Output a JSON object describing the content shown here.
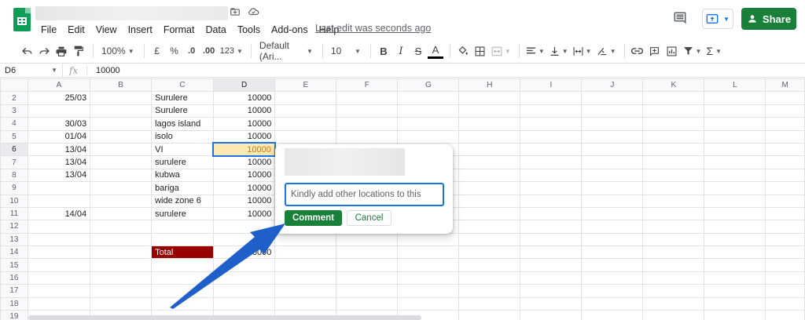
{
  "header": {
    "menu": [
      "File",
      "Edit",
      "View",
      "Insert",
      "Format",
      "Data",
      "Tools",
      "Add-ons",
      "Help"
    ],
    "last_edit": "Last edit was seconds ago",
    "share_label": "Share"
  },
  "toolbar": {
    "zoom": "100%",
    "currency": "£",
    "percent": "%",
    "decimal_decrease": ".0",
    "decimal_increase": ".00",
    "more_formats": "123",
    "font": "Default (Ari...",
    "font_size": "10",
    "bold": "B",
    "italic": "I",
    "strike": "S",
    "text_color": "A",
    "sum": "Σ"
  },
  "formula_bar": {
    "cell_ref": "D6",
    "fx": "fx",
    "value": "10000"
  },
  "sheet": {
    "columns": [
      "A",
      "B",
      "C",
      "D",
      "E",
      "F",
      "G",
      "H",
      "I",
      "J",
      "K",
      "L",
      "M"
    ],
    "rows": [
      {
        "n": "2",
        "a": "25/03",
        "b": "",
        "c": "Surulere",
        "d": "10000"
      },
      {
        "n": "3",
        "a": "",
        "b": "",
        "c": "Surulere",
        "d": "10000"
      },
      {
        "n": "4",
        "a": "30/03",
        "b": "",
        "c": "lagos island",
        "d": "10000"
      },
      {
        "n": "5",
        "a": "01/04",
        "b": "",
        "c": "isolo",
        "d": "10000"
      },
      {
        "n": "6",
        "a": "13/04",
        "b": "",
        "c": "VI",
        "d": "10000"
      },
      {
        "n": "7",
        "a": "13/04",
        "b": "",
        "c": "surulere",
        "d": "10000"
      },
      {
        "n": "8",
        "a": "13/04",
        "b": "",
        "c": "kubwa",
        "d": "10000"
      },
      {
        "n": "9",
        "a": "",
        "b": "",
        "c": "bariga",
        "d": "10000"
      },
      {
        "n": "10",
        "a": "",
        "b": "",
        "c": "wide zone 6",
        "d": "10000"
      },
      {
        "n": "11",
        "a": "14/04",
        "b": "",
        "c": "surulere",
        "d": "10000"
      },
      {
        "n": "12",
        "a": "",
        "b": "",
        "c": "",
        "d": ""
      },
      {
        "n": "13",
        "a": "",
        "b": "",
        "c": "",
        "d": ""
      },
      {
        "n": "14",
        "a": "",
        "b": "",
        "c": "Total",
        "d": "00000"
      },
      {
        "n": "15",
        "a": "",
        "b": "",
        "c": "",
        "d": ""
      },
      {
        "n": "16",
        "a": "",
        "b": "",
        "c": "",
        "d": ""
      },
      {
        "n": "17",
        "a": "",
        "b": "",
        "c": "",
        "d": ""
      },
      {
        "n": "18",
        "a": "",
        "b": "",
        "c": "",
        "d": ""
      },
      {
        "n": "19",
        "a": "",
        "b": "",
        "c": "",
        "d": ""
      }
    ]
  },
  "comment_box": {
    "text": "Kindly add other locations to this",
    "comment_label": "Comment",
    "cancel_label": "Cancel"
  },
  "colors": {
    "brand_green": "#188038",
    "total_fill": "#980000",
    "active_fill": "#fce8b2",
    "selection_blue": "#1a73e8",
    "arrow_blue": "#1f5fc9"
  },
  "icons": [
    "sheets-logo-icon",
    "move-to-folder-icon",
    "cloud-saved-icon",
    "comment-history-icon",
    "present-icon",
    "person-add-icon",
    "undo-icon",
    "redo-icon",
    "print-icon",
    "paint-format-icon",
    "fill-color-icon",
    "borders-icon",
    "merge-cells-icon",
    "align-left-icon",
    "vertical-align-icon",
    "text-wrap-icon",
    "text-rotate-icon",
    "link-icon",
    "insert-comment-icon",
    "insert-chart-icon",
    "filter-icon",
    "annotation-arrow-icon"
  ]
}
